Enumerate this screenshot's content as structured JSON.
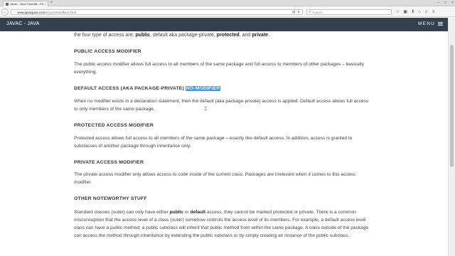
{
  "browser": {
    "tab_title": "Javac - Java Tutorials - Pac...",
    "tab_close": "×",
    "new_tab": "+",
    "window_controls": {
      "minimize": "–",
      "maximize": "□",
      "close": "×"
    },
    "back": "←",
    "url_info": "ⓘ",
    "url_domain": "www.javacjava.com",
    "url_path": "/AccessModifiers.html",
    "search_placeholder": "Search",
    "search_glass": "⚲",
    "url_icons": [
      "▤",
      "↻"
    ],
    "toolbar_icons": [
      "☆",
      "▣",
      "⬇",
      "⌂",
      "☺",
      "≡"
    ]
  },
  "site": {
    "logo": "JAVAC - JAVA",
    "menu_label": "MENU"
  },
  "article": {
    "intro_before": "the four type of access are: ",
    "intro_public": "public",
    "intro_mid": ", default aka package-private, ",
    "intro_protected": "protected",
    "intro_and": ", and ",
    "intro_private": "private",
    "intro_end": ".",
    "public_heading": "PUBLIC ACCESS MODIFIER",
    "public_text": "The public access modifier allows full access to all members of the same package and full access to members of other packages – basically everything.",
    "default_heading_prefix": "DEFAULT ACCESS (AKA PACKAGE-PRIVATE) ",
    "default_heading_highlight": "NO-MODIFIER",
    "default_text": "When no modifier exists in a declaration statement, then the default (aka package-private) access is applied. Default access allows full access to only members of the same package.",
    "protected_heading": "PROTECTED ACCESS MODIFIER",
    "protected_text": "Protected access allows full access to all members of the same package – exactly like default access. In addition, access is granted to subclasses of another package through inheritance only.",
    "private_heading": "PRIVATE ACCESS MODIFIER",
    "private_text": "The private access modifier only allows access to code inside of the current class. Packages are irrelevant when it comes to this access modifier.",
    "other_heading": "OTHER NOTEWORTHY STUFF",
    "other_p1": "Standard classes (outer) can only have either ",
    "other_public": "public",
    "other_or": " or ",
    "other_default": "default",
    "other_p2": " access, they cannot be marked protected or private. There is a common misconception that the access level of a class (outer) somehow controls the access level of its members. For example, a default access level class can have a public method; a public subclass will inherit that public method from within the same package. A class outside of the package can access the method through inheritance by extending the public subclass or by simply creating an instance of the public subclass."
  },
  "cursor_glyph": "⌶",
  "colors": {
    "header_bg": "#33414e",
    "selection": "#3399ff",
    "body_text": "#444444"
  }
}
